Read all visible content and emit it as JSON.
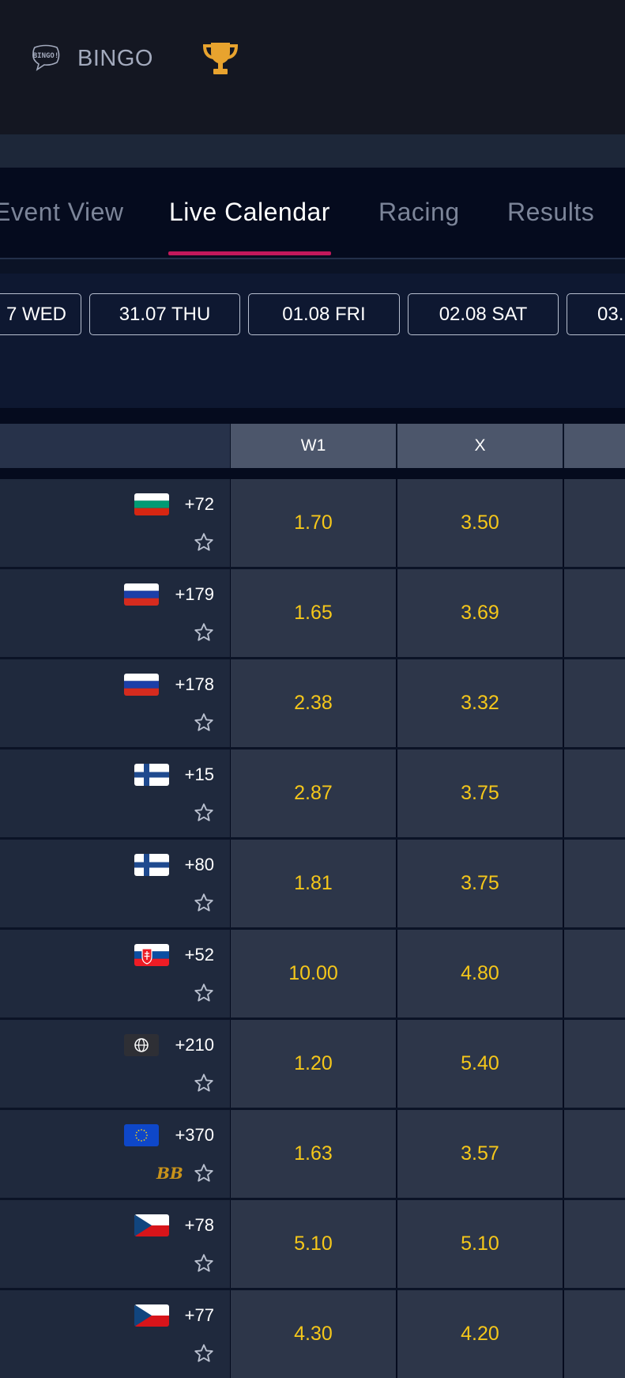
{
  "topbar": {
    "bingo_label": "BINGO",
    "bingo_icon_text": "BINGO!"
  },
  "tabs": [
    {
      "label": "Event View",
      "active": false
    },
    {
      "label": "Live Calendar",
      "active": true
    },
    {
      "label": "Racing",
      "active": false
    },
    {
      "label": "Results",
      "active": false
    }
  ],
  "dates": [
    "7 WED",
    "31.07 THU",
    "01.08 FRI",
    "02.08 SAT",
    "03."
  ],
  "columns": [
    "W1",
    "X"
  ],
  "rows": [
    {
      "flag": "bulgaria",
      "count": "+72",
      "w1": "1.70",
      "x": "3.50",
      "bb": false
    },
    {
      "flag": "russia",
      "count": "+179",
      "w1": "1.65",
      "x": "3.69",
      "bb": false
    },
    {
      "flag": "russia",
      "count": "+178",
      "w1": "2.38",
      "x": "3.32",
      "bb": false
    },
    {
      "flag": "finland",
      "count": "+15",
      "w1": "2.87",
      "x": "3.75",
      "bb": false
    },
    {
      "flag": "finland",
      "count": "+80",
      "w1": "1.81",
      "x": "3.75",
      "bb": false
    },
    {
      "flag": "slovakia",
      "count": "+52",
      "w1": "10.00",
      "x": "4.80",
      "bb": false
    },
    {
      "flag": "world",
      "count": "+210",
      "w1": "1.20",
      "x": "5.40",
      "bb": false
    },
    {
      "flag": "eu",
      "count": "+370",
      "w1": "1.63",
      "x": "3.57",
      "bb": true
    },
    {
      "flag": "czech",
      "count": "+78",
      "w1": "5.10",
      "x": "5.10",
      "bb": false
    },
    {
      "flag": "czech",
      "count": "+77",
      "w1": "4.30",
      "x": "4.20",
      "bb": false
    }
  ],
  "bb_label": "BB",
  "colors": {
    "accent": "#c2185b",
    "odds": "#f5c71a",
    "trophy": "#e8a32e"
  }
}
